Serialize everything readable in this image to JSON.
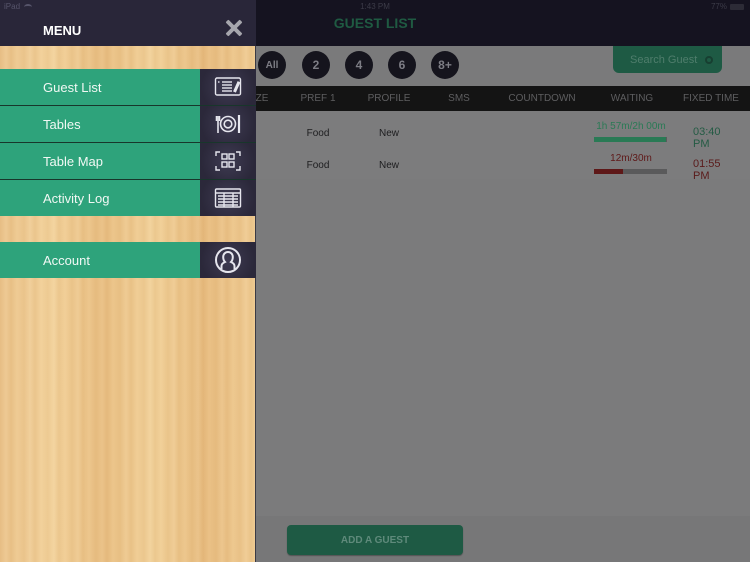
{
  "status_bar": {
    "device": "iPad",
    "time": "1:43 PM",
    "battery": "77%"
  },
  "header": {
    "title": "GUEST LIST"
  },
  "filters": {
    "party_size_buttons": [
      "All",
      "2",
      "4",
      "6",
      "8+"
    ],
    "search_label": "Search Guest"
  },
  "table": {
    "columns": [
      "ZE",
      "PREF 1",
      "PROFILE",
      "SMS",
      "COUNTDOWN",
      "WAITING",
      "FIXED TIME"
    ],
    "rows": [
      {
        "pref1": "Food",
        "profile": "New",
        "sms": "",
        "countdown": "",
        "waiting": "1h 57m/2h 00m",
        "waiting_progress": 0.98,
        "waiting_color": "#2a7a55",
        "fixed_time": "03:40 PM",
        "fixed_time_color": "#245b44"
      },
      {
        "pref1": "Food",
        "profile": "New",
        "sms": "",
        "countdown": "",
        "waiting": "12m/30m",
        "waiting_progress": 0.4,
        "waiting_color": "#5e1818",
        "fixed_time": "01:55 PM",
        "fixed_time_color": "#5a1a1a"
      }
    ]
  },
  "footer": {
    "add_guest_label": "ADD A GUEST"
  },
  "menu": {
    "title": "MENU",
    "close_icon": "close-icon",
    "items": [
      {
        "label": "Guest List",
        "icon": "guest-list-icon"
      },
      {
        "label": "Tables",
        "icon": "plate-icon"
      },
      {
        "label": "Table Map",
        "icon": "table-map-icon"
      },
      {
        "label": "Activity Log",
        "icon": "activity-log-icon"
      },
      {
        "label": "Account",
        "icon": "account-icon"
      }
    ]
  },
  "colors": {
    "menu_green": "#2ea37b",
    "menu_dark": "#292639",
    "accent_green": "#1e5a44"
  }
}
